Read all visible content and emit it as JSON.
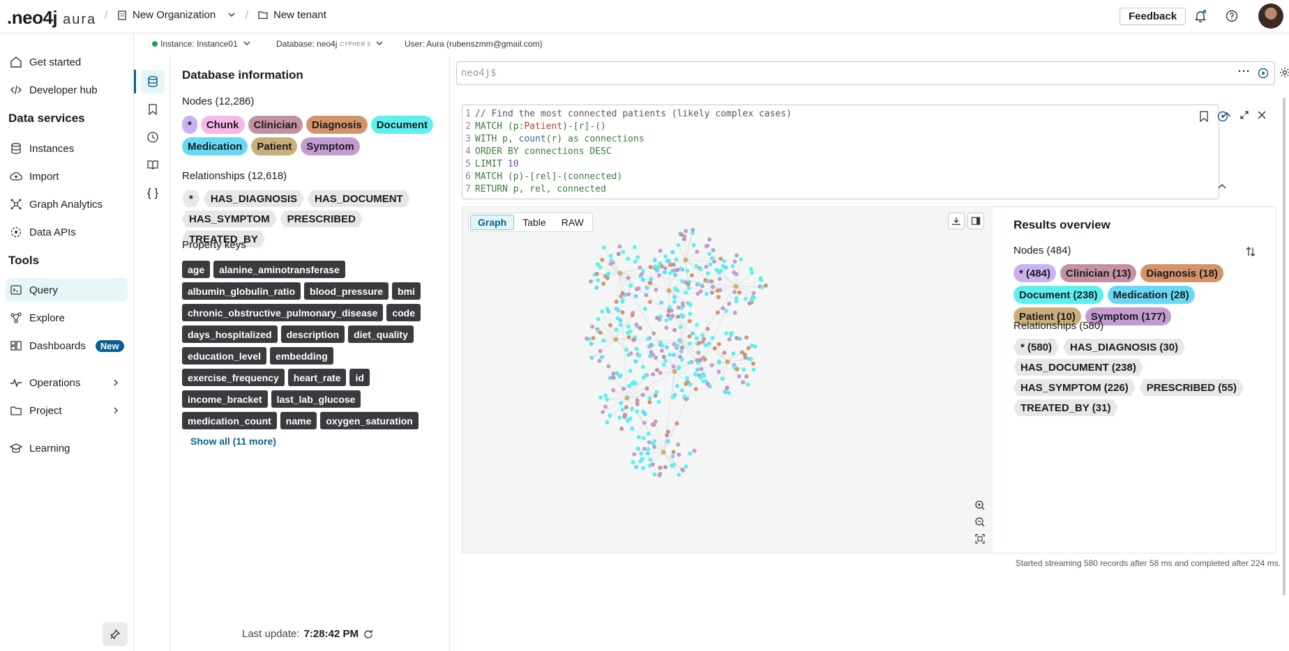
{
  "topbar": {
    "logo": ".neo4j",
    "logo_suffix": "aura",
    "organization": "New Organization",
    "tenant": "New tenant",
    "feedback_label": "Feedback"
  },
  "subheader": {
    "instance": "Instance: Instance01",
    "database": "Database: neo4j",
    "database_tag": "CYPHER 5",
    "user": "User: Aura (rubenszmm@gmail.com)"
  },
  "leftnav": {
    "get_started": "Get started",
    "developer_hub": "Developer hub",
    "data_services": "Data services",
    "instances": "Instances",
    "import": "Import",
    "graph_analytics": "Graph Analytics",
    "data_apis": "Data APIs",
    "tools": "Tools",
    "query": "Query",
    "explore": "Explore",
    "dashboards": "Dashboards",
    "new_badge": "New",
    "operations": "Operations",
    "project": "Project",
    "learning": "Learning"
  },
  "dbinfo": {
    "title": "Database information",
    "nodes_label": "Nodes (12,286)",
    "node_labels": [
      {
        "label": "*",
        "color": "#c9b1f2"
      },
      {
        "label": "Chunk",
        "color": "#f9b6e8"
      },
      {
        "label": "Clinician",
        "color": "#c490a4"
      },
      {
        "label": "Diagnosis",
        "color": "#d5936a"
      },
      {
        "label": "Document",
        "color": "#5cf0f0"
      },
      {
        "label": "Medication",
        "color": "#68d9f5"
      },
      {
        "label": "Patient",
        "color": "#c9ae7c"
      },
      {
        "label": "Symptom",
        "color": "#c39ccf"
      }
    ],
    "rels_label": "Relationships (12,618)",
    "rel_types": [
      "*",
      "HAS_DIAGNOSIS",
      "HAS_DOCUMENT",
      "HAS_SYMPTOM",
      "PRESCRIBED",
      "TREATED_BY"
    ],
    "props_label": "Property keys",
    "props": [
      "age",
      "alanine_aminotransferase",
      "albumin_globulin_ratio",
      "blood_pressure",
      "bmi",
      "chronic_obstructive_pulmonary_disease",
      "code",
      "days_hospitalized",
      "description",
      "diet_quality",
      "education_level",
      "embedding",
      "exercise_frequency",
      "heart_rate",
      "id",
      "income_bracket",
      "last_lab_glucose",
      "medication_count",
      "name",
      "oxygen_saturation"
    ],
    "show_all": "Show all (11 more)",
    "last_update_label": "Last update:",
    "last_update_time": "7:28:42 PM"
  },
  "query": {
    "prompt": "neo4j$",
    "code": [
      "// Find the most connected patients (likely complex cases)",
      "MATCH (p:Patient)-[r]-()",
      "WITH p, count(r) as connections",
      "ORDER BY connections DESC",
      "LIMIT 10",
      "MATCH (p)-[rel]-(connected)",
      "RETURN p, rel, connected"
    ]
  },
  "result": {
    "tabs": [
      "Graph",
      "Table",
      "RAW"
    ],
    "active_tab": "Graph",
    "overview_title": "Results overview",
    "nodes_label": "Nodes (484)",
    "node_counts": [
      {
        "label": "* (484)",
        "color": "#c9b1f2"
      },
      {
        "label": "Clinician (13)",
        "color": "#c490a4"
      },
      {
        "label": "Diagnosis (18)",
        "color": "#d5936a"
      },
      {
        "label": "Document (238)",
        "color": "#5cf0f0"
      },
      {
        "label": "Medication (28)",
        "color": "#68d9f5"
      },
      {
        "label": "Patient (10)",
        "color": "#c9ae7c"
      },
      {
        "label": "Symptom (177)",
        "color": "#c39ccf"
      }
    ],
    "rels_label": "Relationships (580)",
    "rel_counts": [
      "* (580)",
      "HAS_DIAGNOSIS (30)",
      "HAS_DOCUMENT (238)",
      "HAS_SYMPTOM (226)",
      "PRESCRIBED (55)",
      "TREATED_BY (31)"
    ],
    "status": "Started streaming 580 records after 58 ms and completed after 224 ms."
  },
  "graph_colors": {
    "patient": "#c9ae7c",
    "document": "#5cf0f0",
    "symptom": "#c39ccf",
    "diagnosis": "#d5936a",
    "clinician": "#c490a4",
    "medication": "#68d9f5"
  }
}
